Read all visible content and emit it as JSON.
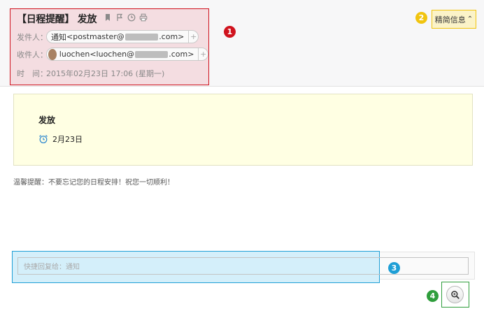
{
  "mail": {
    "subject": "【日程提醒】 发放",
    "sender_label": "发件人：",
    "sender_name": "通知",
    "sender_email_prefix": "<postmaster@",
    "sender_email_suffix": ".com>",
    "recipient_label": "收件人：",
    "recipient_name": "luochen",
    "recipient_email_prefix": "<luochen@",
    "recipient_email_suffix": ".com>",
    "time_label": "时　间：",
    "time_value": "2015年02月23日 17:06 (星期一)",
    "plus": "+"
  },
  "toolbar_icons": [
    "bookmark-icon",
    "flag-icon",
    "clock-icon",
    "print-icon"
  ],
  "detail_button": {
    "label": "精简信息",
    "chevron": "⌃"
  },
  "reminder": {
    "title": "发放",
    "date": "2月23日"
  },
  "note": "温馨提醒：不要忘记您的日程安排！祝您一切顺利！",
  "quick_reply": {
    "placeholder": "快捷回复给：通知"
  },
  "badges": [
    {
      "label": "1",
      "color": "#d0131e"
    },
    {
      "label": "2",
      "color": "#f1c40f"
    },
    {
      "label": "3",
      "color": "#1e9fd6"
    },
    {
      "label": "4",
      "color": "#2f9e3c"
    }
  ]
}
